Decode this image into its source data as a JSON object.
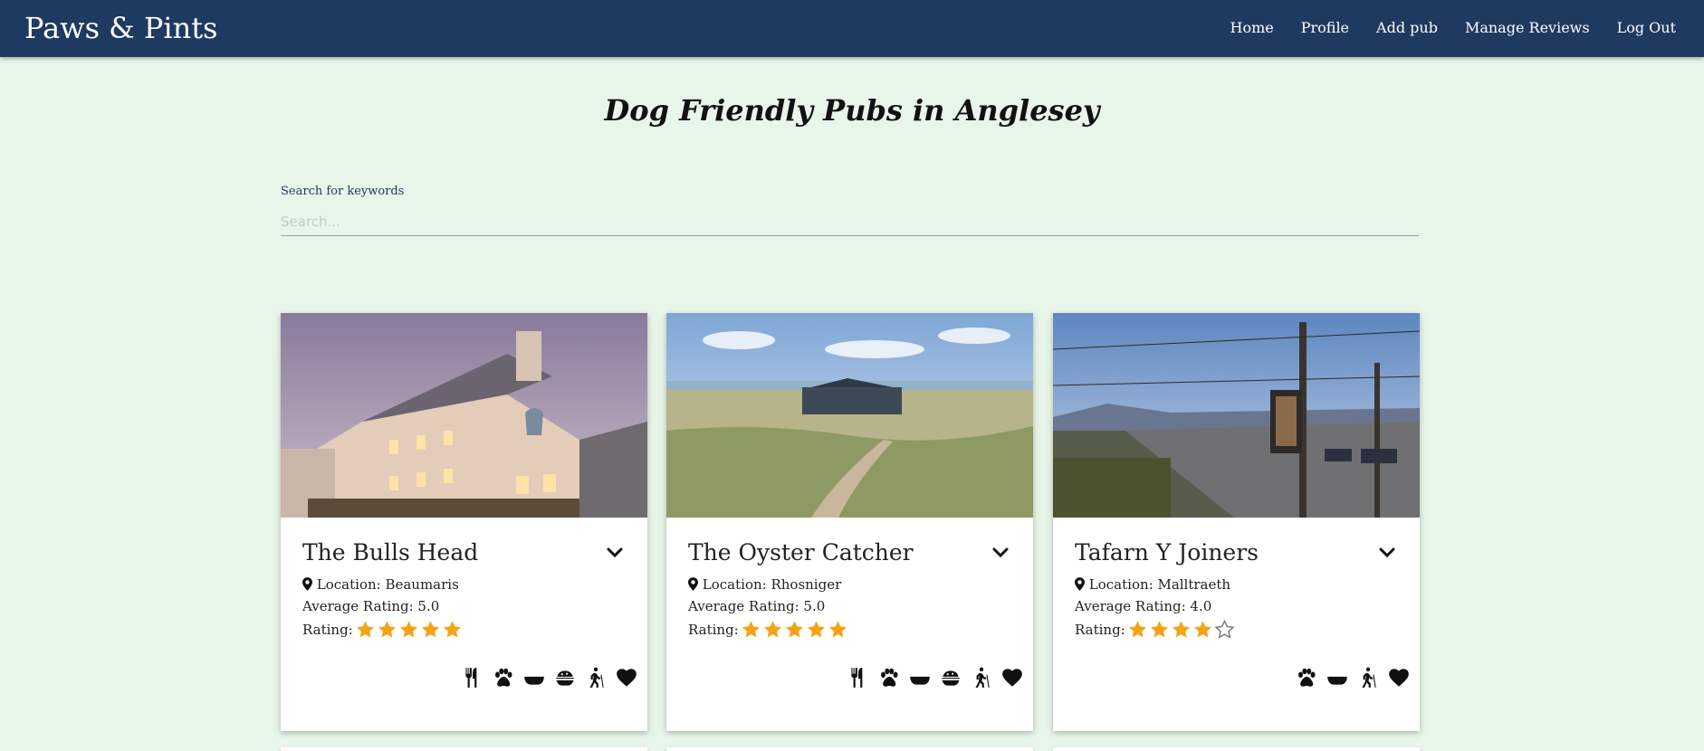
{
  "nav": {
    "brand": "Paws & Pints",
    "links": [
      "Home",
      "Profile",
      "Add pub",
      "Manage Reviews",
      "Log Out"
    ]
  },
  "page": {
    "title": "Dog Friendly Pubs in Anglesey"
  },
  "search": {
    "label": "Search for keywords",
    "placeholder": "Search...",
    "value": ""
  },
  "cards": [
    {
      "name": "The Bulls Head",
      "location": "Location: Beaumaris",
      "average": "Average Rating: 5.0",
      "rating_label": "Rating:",
      "stars_filled": 5,
      "amenities": [
        "food-icon",
        "paw-icon",
        "water-bowl-icon",
        "dog-food-icon",
        "walking-icon",
        "heart-icon"
      ]
    },
    {
      "name": "The Oyster Catcher",
      "location": "Location: Rhosniger",
      "average": "Average Rating: 5.0",
      "rating_label": "Rating:",
      "stars_filled": 5,
      "amenities": [
        "food-icon",
        "paw-icon",
        "water-bowl-icon",
        "dog-food-icon",
        "walking-icon",
        "heart-icon"
      ]
    },
    {
      "name": "Tafarn Y Joiners",
      "location": "Location: Malltraeth",
      "average": "Average Rating: 4.0",
      "rating_label": "Rating:",
      "stars_filled": 4,
      "amenities": [
        "paw-icon",
        "water-bowl-icon",
        "walking-icon",
        "heart-icon"
      ]
    }
  ],
  "colors": {
    "navbar": "#1f3a60",
    "background": "#e8f5e9",
    "star": "#f5a316"
  }
}
